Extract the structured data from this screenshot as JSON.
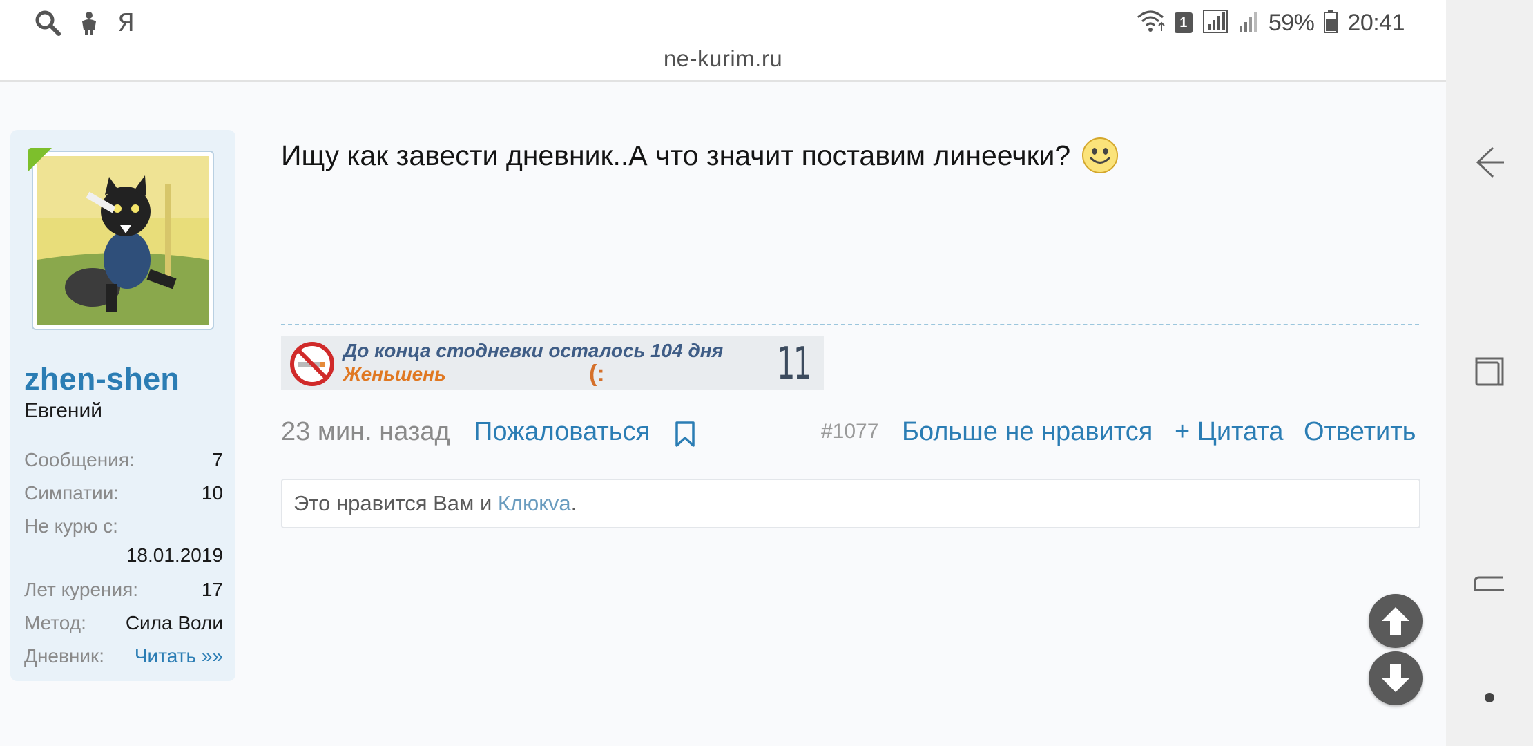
{
  "status_bar": {
    "yandex_glyph": "Я",
    "sim_slot": "1",
    "battery_percent": "59%",
    "time": "20:41",
    "icons": [
      "search-icon",
      "android-icon",
      "wifi-icon",
      "signal-icon",
      "battery-icon"
    ]
  },
  "browser": {
    "url": "ne-kurim.ru"
  },
  "user": {
    "username": "zhen-shen",
    "real_name": "Евгений",
    "online": true,
    "stats": {
      "messages_label": "Сообщения:",
      "messages_value": "7",
      "likes_label": "Симпатии:",
      "likes_value": "10",
      "quit_label": "Не курю с:",
      "quit_value": "18.01.2019",
      "years_label": "Лет курения:",
      "years_value": "17",
      "method_label": "Метод:",
      "method_value": "Сила Воли",
      "diary_label": "Дневник:",
      "diary_value": "Читать »»"
    }
  },
  "post": {
    "text": "Ищу как завести дневник..А что значит поставим линеечки?",
    "signature_banner": {
      "line1": "До конца стодневки осталось 104 дня",
      "line2": "Женьшень",
      "emoticon": "(:",
      "day_counter": "11"
    },
    "time_ago": "23 мин. назад",
    "report_label": "Пожаловаться",
    "post_number": "#1077",
    "unlike_label": "Больше не нравится",
    "quote_label": "+ Цитата",
    "reply_label": "Ответить",
    "likes_prefix": "Это нравится Вам и ",
    "likes_user": "Клюкva",
    "likes_suffix": "."
  },
  "colors": {
    "accent": "#2b7db4",
    "online": "#7dbf2c",
    "card_bg": "#e9f2f9",
    "separator": "#9cc6dd"
  }
}
